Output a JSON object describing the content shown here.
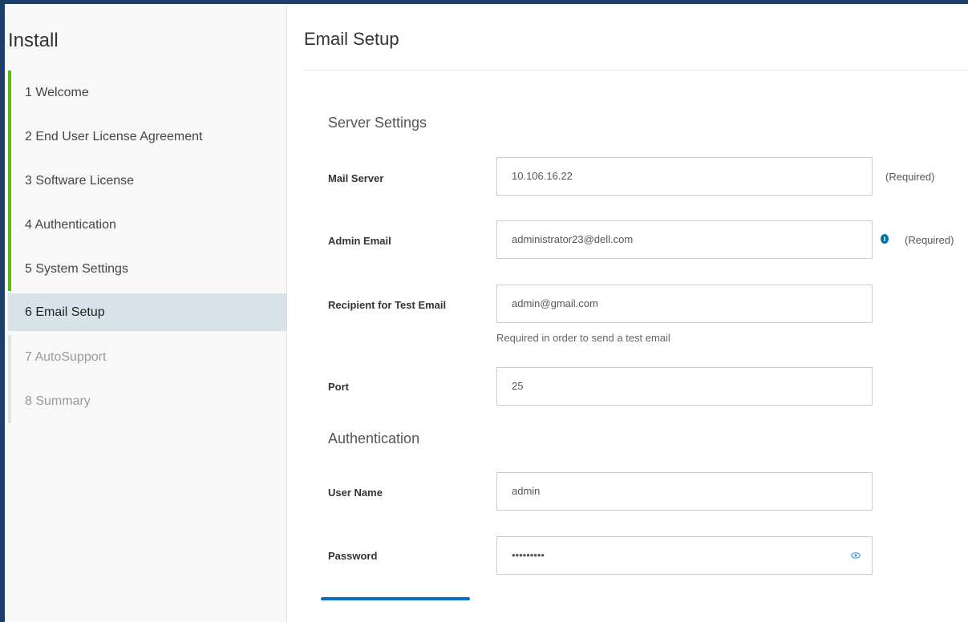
{
  "sidebar": {
    "title": "Install",
    "steps": [
      {
        "label": "1 Welcome",
        "state": "done"
      },
      {
        "label": "2 End User License Agreement",
        "state": "done"
      },
      {
        "label": "3 Software License",
        "state": "done"
      },
      {
        "label": "4 Authentication",
        "state": "done"
      },
      {
        "label": "5 System Settings",
        "state": "done"
      },
      {
        "label": "6 Email Setup",
        "state": "active"
      },
      {
        "label": "7 AutoSupport",
        "state": "pending"
      },
      {
        "label": "8 Summary",
        "state": "pending"
      }
    ]
  },
  "main": {
    "title": "Email Setup",
    "server_section": "Server Settings",
    "auth_section": "Authentication",
    "fields": {
      "mail_server": {
        "label": "Mail Server",
        "value": "10.106.16.22",
        "note": "(Required)"
      },
      "admin_email": {
        "label": "Admin Email",
        "value": "administrator23@dell.com",
        "note": "(Required)"
      },
      "test_recipient": {
        "label": "Recipient for Test Email",
        "value": "admin@gmail.com",
        "helper": "Required in order to send a test email"
      },
      "port": {
        "label": "Port",
        "value": "25"
      },
      "user_name": {
        "label": "User Name",
        "value": "admin"
      },
      "password": {
        "label": "Password",
        "value": "•••••••••"
      }
    }
  },
  "colors": {
    "frame": "#1e3f66",
    "step_done": "#5eb715",
    "step_active_bg": "#d8e3e9",
    "accent": "#0072c6"
  },
  "icons": {
    "info": "info-circle-icon",
    "password_toggle": "eye-icon"
  }
}
